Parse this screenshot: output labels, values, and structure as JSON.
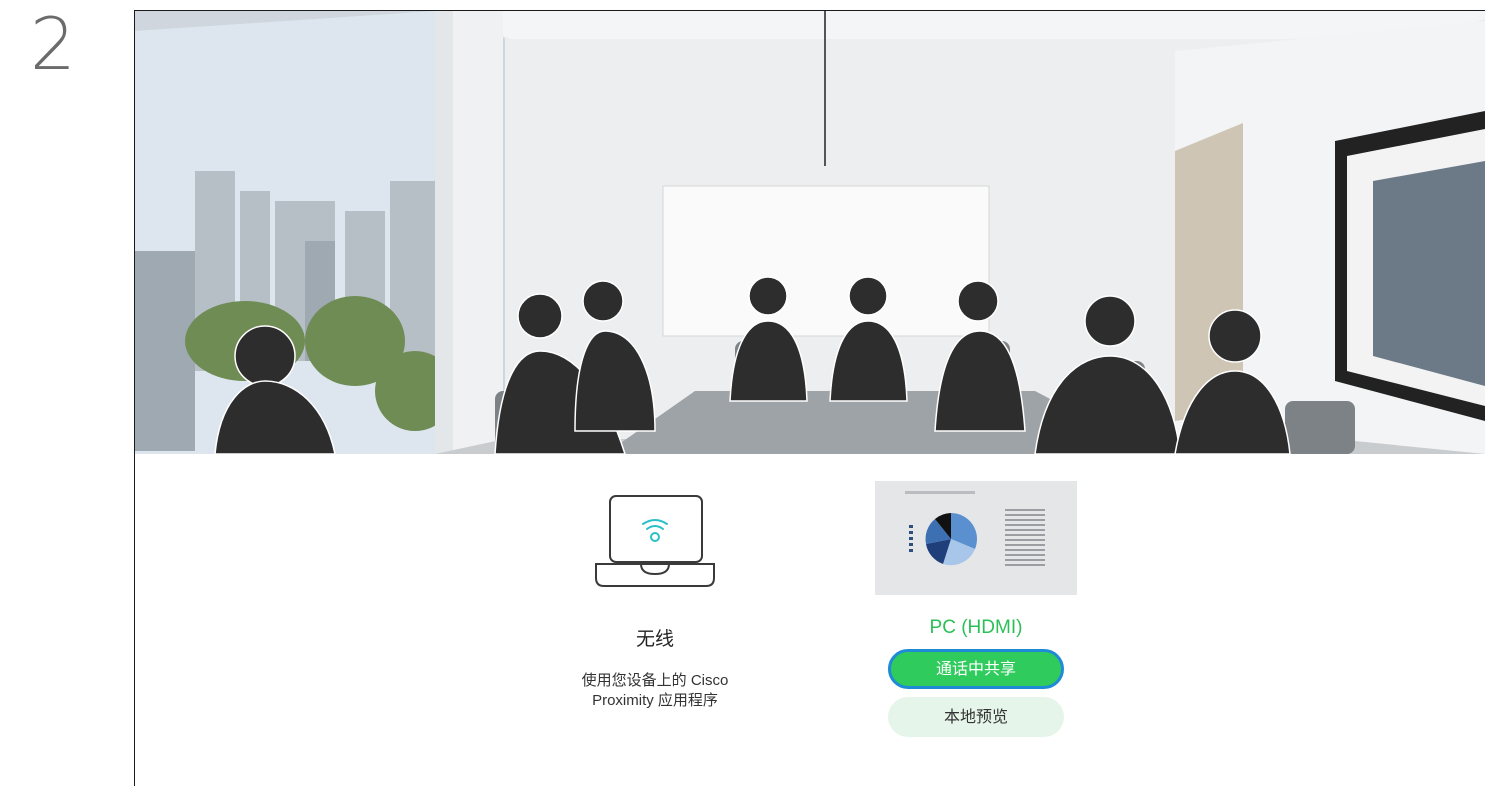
{
  "step": {
    "number": "2"
  },
  "sources": {
    "wireless": {
      "icon": "laptop-wifi-icon",
      "title": "无线",
      "description_line1": "使用您设备上的 Cisco",
      "description_line2": "Proximity 应用程序"
    },
    "pc": {
      "thumbnail": "pc-presentation-thumbnail",
      "title": "PC (HDMI)",
      "share_button": "通话中共享",
      "preview_button": "本地预览"
    }
  },
  "colors": {
    "accent_green": "#2fcb5c",
    "focus_blue": "#1f8bd6",
    "wifi_icon": "#2ac0c8",
    "preview_bg": "#e6f5ea"
  }
}
